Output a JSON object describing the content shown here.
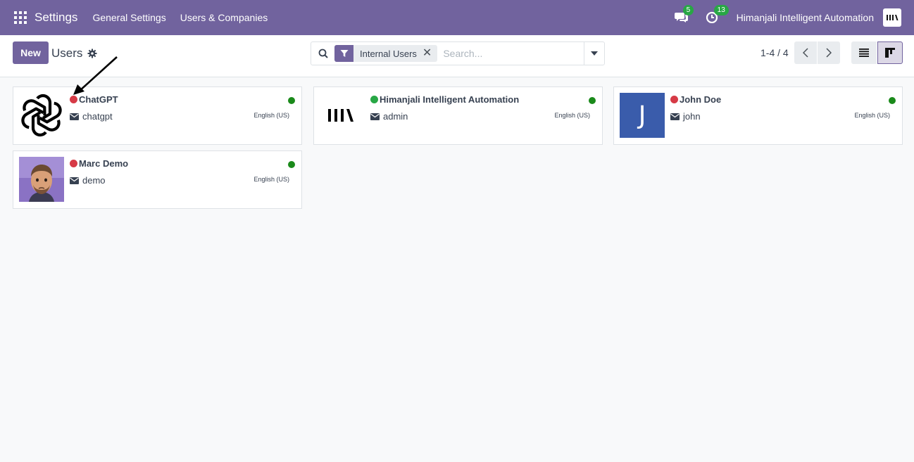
{
  "navbar": {
    "app_name": "Settings",
    "menus": [
      "General Settings",
      "Users & Companies"
    ],
    "messages_count": "5",
    "activities_count": "13",
    "company_name": "Himanjali Intelligent Automation",
    "brand_color": "#71639e"
  },
  "control_panel": {
    "new_label": "New",
    "breadcrumb": "Users",
    "search": {
      "facet_label": "Internal Users",
      "placeholder": "Search..."
    },
    "pager": "1-4 / 4"
  },
  "cards": [
    {
      "name": "ChatGPT",
      "login": "chatgpt",
      "lang": "English (US)",
      "presence": "red",
      "image": "openai-logo-icon"
    },
    {
      "name": "Himanjali Intelligent Automation",
      "login": "admin",
      "lang": "English (US)",
      "presence": "green",
      "image": "hia-logo-icon"
    },
    {
      "name": "John Doe",
      "login": "john",
      "lang": "English (US)",
      "presence": "red",
      "image": "letter-avatar",
      "avatar_letter": "J"
    },
    {
      "name": "Marc Demo",
      "login": "demo",
      "lang": "English (US)",
      "presence": "red",
      "image": "marc-avatar"
    }
  ]
}
